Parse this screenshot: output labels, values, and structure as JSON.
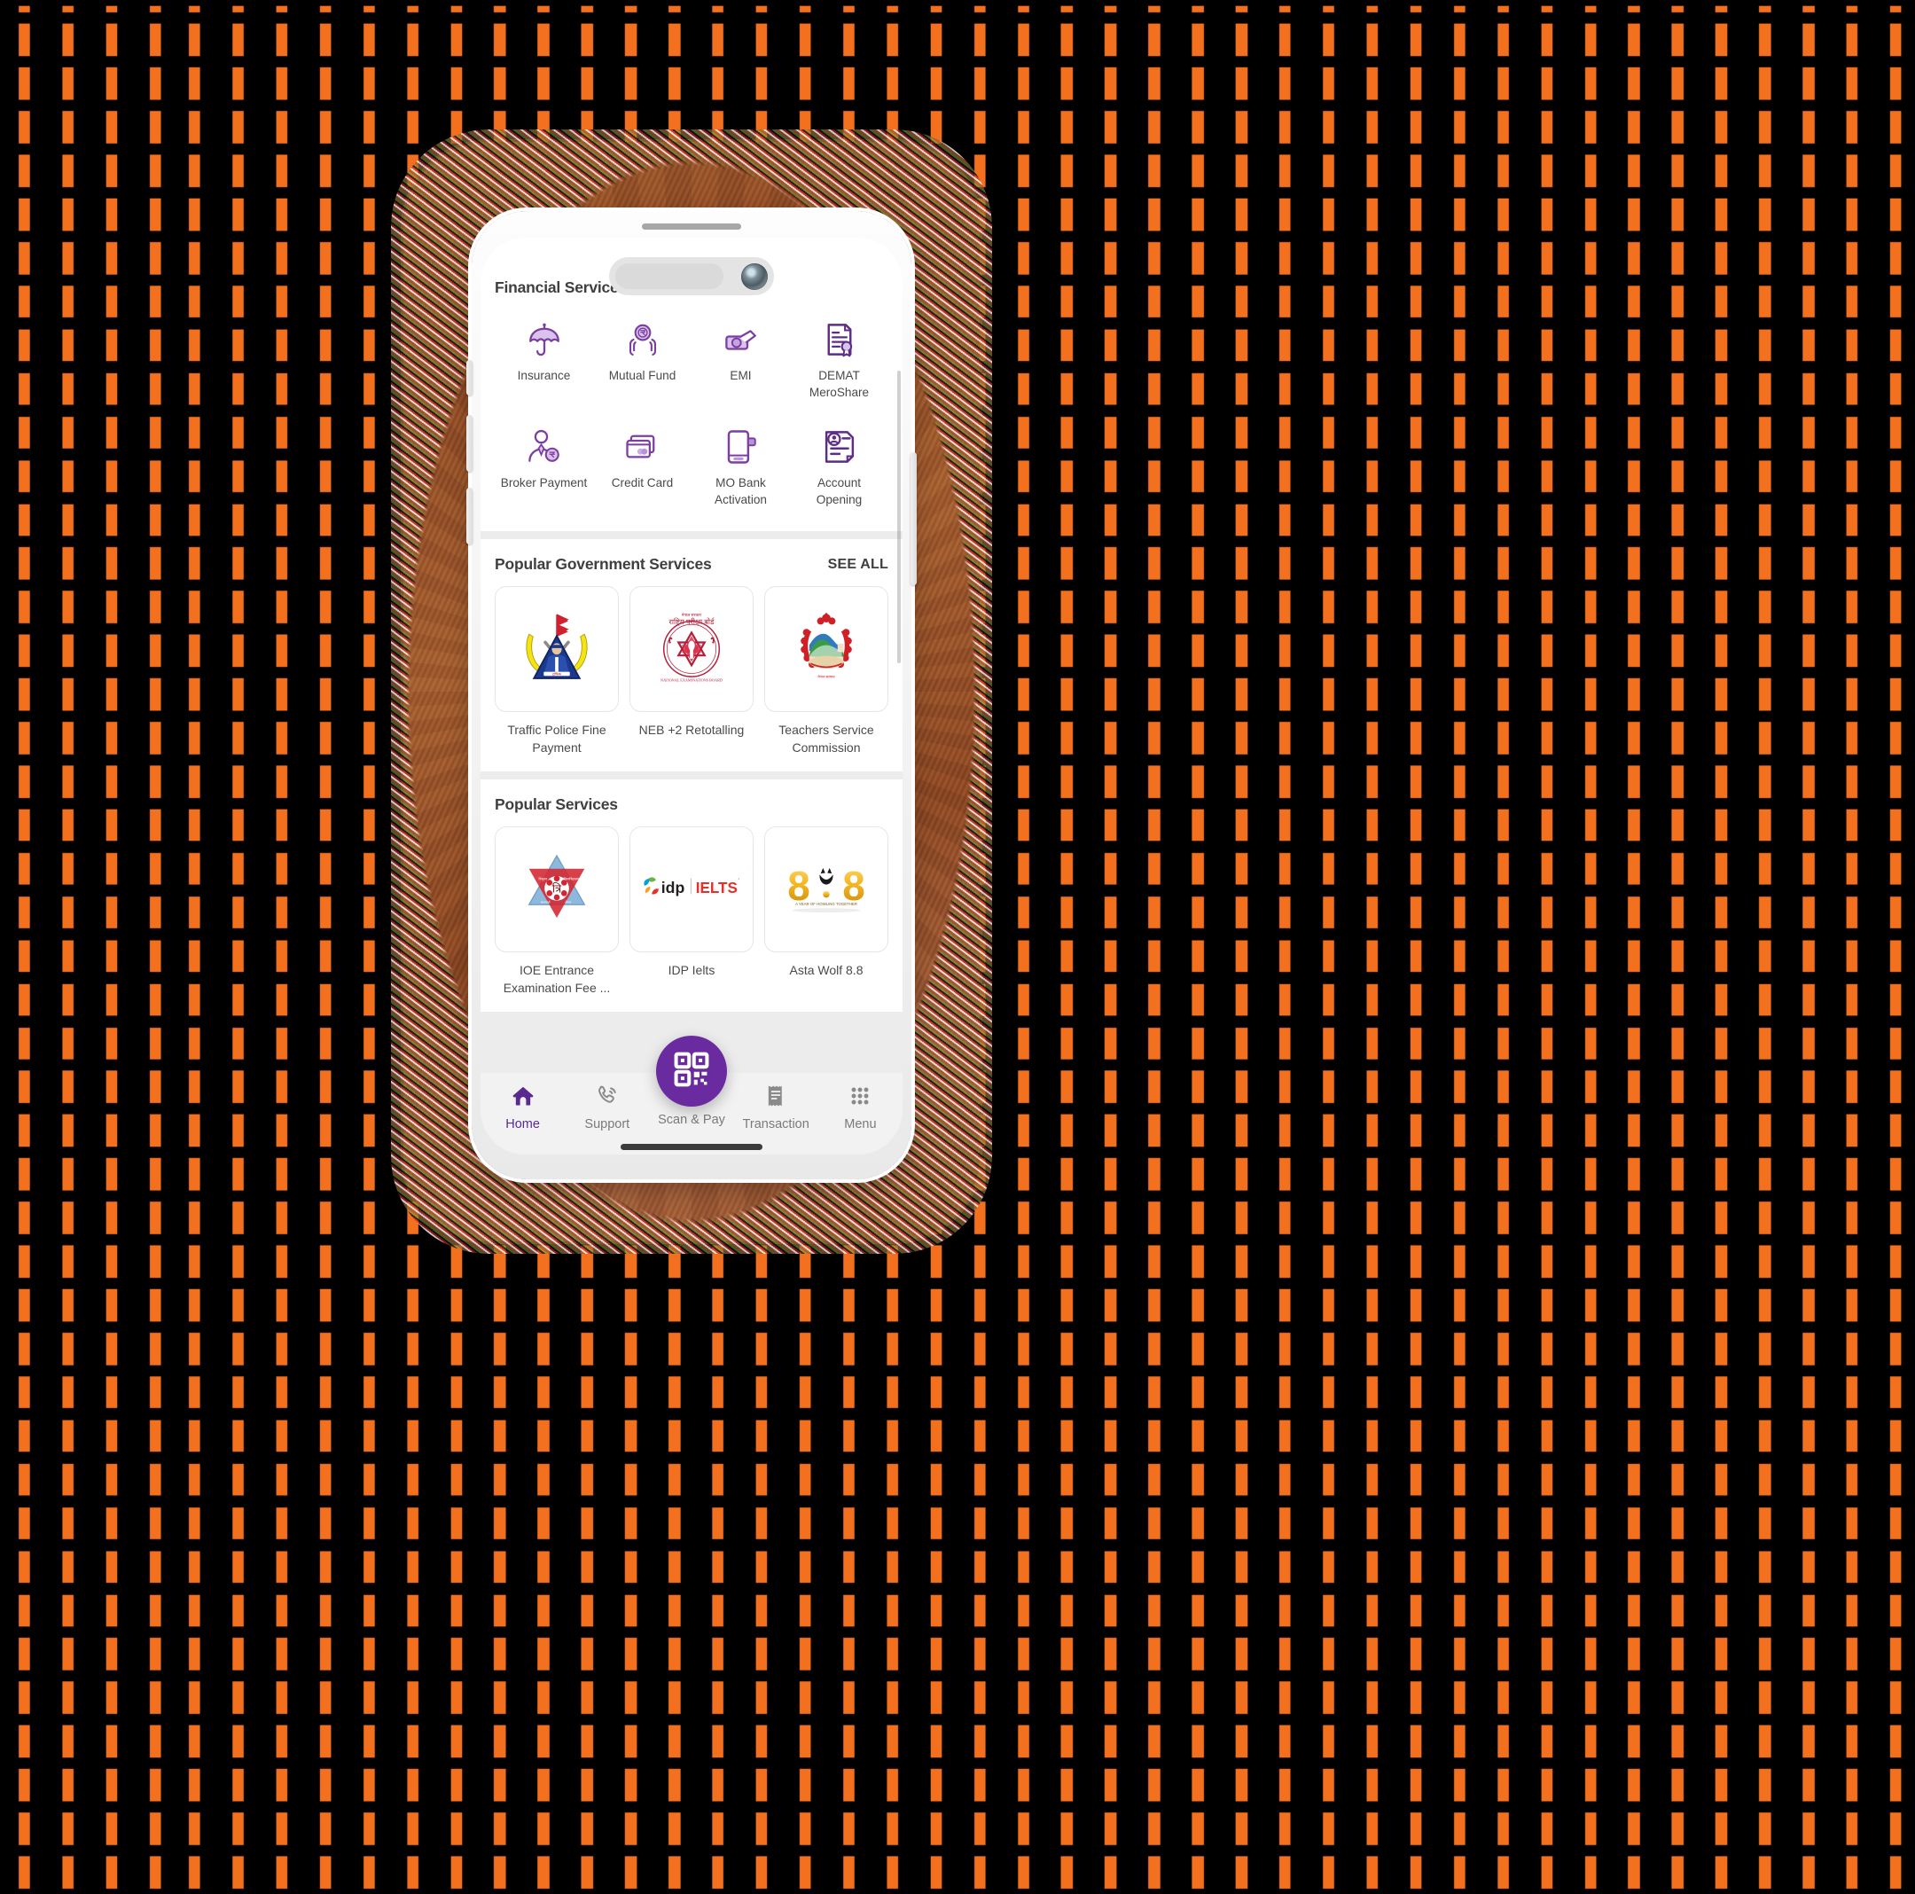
{
  "theme": {
    "background": "#000000",
    "pattern_square": "#f2701e",
    "phone_frame": "#8d4a24",
    "accent_purple": "#6a2aa0",
    "icon_purple": "#7b3fa0",
    "card_background": "#ffffff",
    "screen_background": "#ececec"
  },
  "financial_services": {
    "title": "Financial Services",
    "items": [
      {
        "label": "Insurance",
        "icon": "umbrella-icon"
      },
      {
        "label": "Mutual Fund",
        "icon": "hands-coin-icon"
      },
      {
        "label": "EMI",
        "icon": "cash-hand-icon"
      },
      {
        "label": "DEMAT MeroShare",
        "icon": "certificate-seal-icon"
      },
      {
        "label": "Broker Payment",
        "icon": "person-coin-icon"
      },
      {
        "label": "Credit Card",
        "icon": "credit-cards-icon"
      },
      {
        "label": "MO Bank Activation",
        "icon": "mobile-activation-icon"
      },
      {
        "label": "Account Opening",
        "icon": "account-document-icon"
      }
    ]
  },
  "government_services": {
    "title": "Popular Government Services",
    "see_all_label": "SEE ALL",
    "items": [
      {
        "label": "Traffic Police Fine Payment",
        "logo": "nepal-traffic-police-logo"
      },
      {
        "label": "NEB +2 Retotalling",
        "logo": "national-examinations-board-logo"
      },
      {
        "label": "Teachers Service Commission",
        "logo": "nepal-government-emblem-logo"
      }
    ]
  },
  "popular_services": {
    "title": "Popular Services",
    "items": [
      {
        "label": "IOE Entrance Examination Fee ...",
        "logo": "ioe-tribhuvan-university-logo"
      },
      {
        "label": "IDP Ielts",
        "logo": "idp-ielts-logo"
      },
      {
        "label": "Asta Wolf 8.8",
        "logo": "asta-wolf-88-logo"
      }
    ]
  },
  "bottom_nav": {
    "items": [
      {
        "label": "Home",
        "icon": "home-icon",
        "active": true
      },
      {
        "label": "Support",
        "icon": "phone-support-icon",
        "active": false
      },
      {
        "label": "Scan & Pay",
        "icon": "qr-code-icon",
        "active": false
      },
      {
        "label": "Transaction",
        "icon": "receipt-icon",
        "active": false
      },
      {
        "label": "Menu",
        "icon": "grid-dots-icon",
        "active": false
      }
    ]
  }
}
